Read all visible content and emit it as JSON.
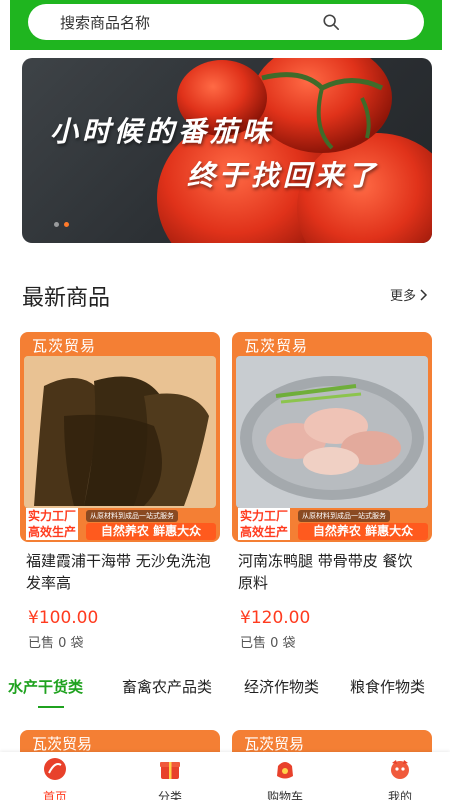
{
  "search": {
    "placeholder": "搜索商品名称"
  },
  "banner": {
    "line1": "小时候的番茄味",
    "line2": "终于找回来了"
  },
  "section": {
    "title": "最新商品",
    "more": "更多"
  },
  "products": [
    {
      "brand": "瓦茨贸易",
      "tag1": "实力工厂",
      "tag2": "高效生产",
      "slogan_small": "从原材料到成品一站式服务",
      "slogan": "自然养农 鲜惠大众",
      "name": "福建霞浦干海带 无沙免洗泡发率高",
      "price": "¥100.00",
      "sold": "已售 0 袋"
    },
    {
      "brand": "瓦茨贸易",
      "tag1": "实力工厂",
      "tag2": "高效生产",
      "slogan_small": "从原材料到成品一站式服务",
      "slogan": "自然养农 鲜惠大众",
      "name": "河南冻鸭腿 带骨带皮 餐饮原料",
      "price": "¥120.00",
      "sold": "已售 0 袋"
    }
  ],
  "tabs": [
    "水产干货类",
    "畜禽农产品类",
    "经济作物类",
    "粮食作物类"
  ],
  "peek": {
    "brand1": "瓦茨贸易",
    "brand2": "瓦茨贸易"
  },
  "nav": [
    {
      "label": "首页",
      "icon": "home-icon"
    },
    {
      "label": "分类",
      "icon": "category-icon"
    },
    {
      "label": "购物车",
      "icon": "cart-icon"
    },
    {
      "label": "我的",
      "icon": "profile-icon"
    }
  ],
  "colors": {
    "accent_green": "#1fb51f",
    "price_red": "#ff3b1f",
    "card_orange": "#f47f34"
  }
}
